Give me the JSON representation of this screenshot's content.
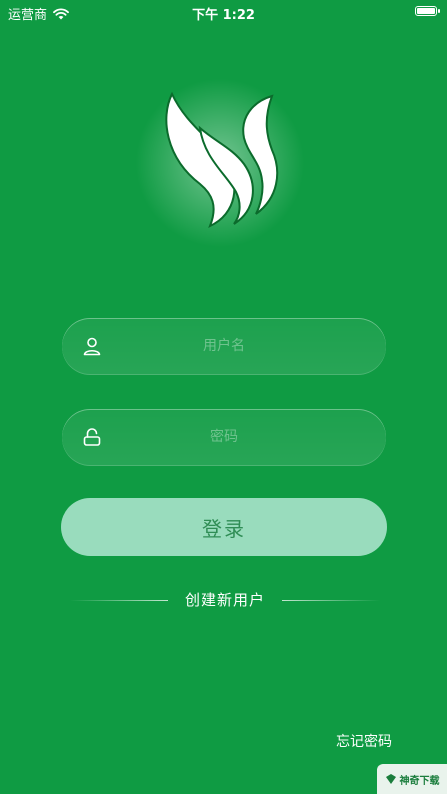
{
  "status_bar": {
    "carrier": "运营商",
    "time": "下午 1:22",
    "wifi_icon": "wifi-icon",
    "battery_icon": "battery-icon"
  },
  "logo": {
    "icon": "leaf-logo-icon",
    "leaf_color": "#ffffff",
    "outline_color": "#0b6b2c"
  },
  "form": {
    "username": {
      "icon": "user-icon",
      "placeholder": "用户名",
      "value": ""
    },
    "password": {
      "icon": "lock-icon",
      "placeholder": "密码",
      "value": ""
    },
    "login_label": "登录",
    "create_user_label": "创建新用户",
    "forgot_password_label": "忘记密码"
  },
  "watermark": {
    "text": "神奇下载"
  },
  "colors": {
    "background": "#0f9b43",
    "login_button": "#99dcbd",
    "login_text": "#2f8d55"
  }
}
